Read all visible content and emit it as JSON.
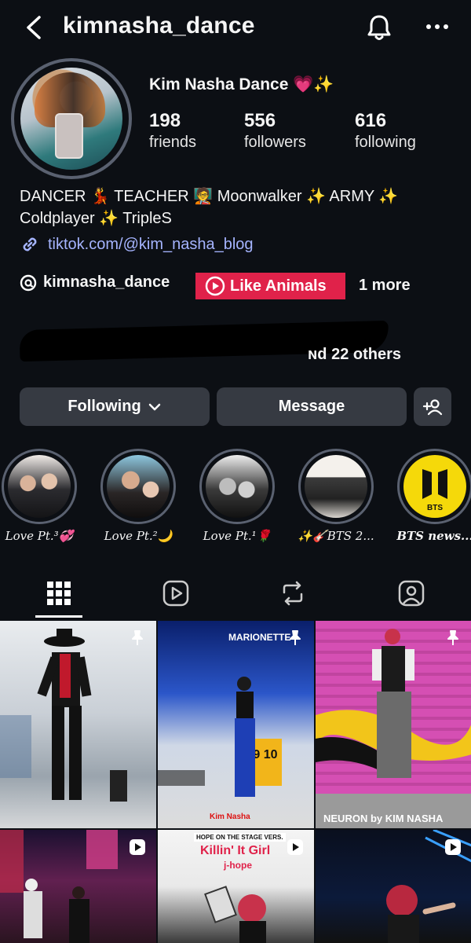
{
  "header": {
    "username": "kimnasha_dance"
  },
  "profile": {
    "display_name": "Kim Nasha Dance 💗✨",
    "stats": [
      {
        "value": "198",
        "label": "friends"
      },
      {
        "value": "556",
        "label": "followers"
      },
      {
        "value": "616",
        "label": "following"
      }
    ],
    "bio_line1": "DANCER 💃 TEACHER 🧑‍🏫 Moonwalker ✨ ARMY ✨",
    "bio_line2": "Coldplayer ✨ TripleS",
    "link": "tiktok.com/@kim_nasha_blog",
    "threads_handle": "kimnasha_dance",
    "pill_label": "Like Animals",
    "more_label": "1 more",
    "mutual_text": "ɴd 22 others"
  },
  "actions": {
    "following_label": "Following",
    "message_label": "Message"
  },
  "highlights": [
    {
      "caption": "Love Pt.³💞"
    },
    {
      "caption": "Love Pt.²🌙"
    },
    {
      "caption": "Love Pt.¹🌹"
    },
    {
      "caption": "✨🎸BTS 2..."
    },
    {
      "caption": "BTS news...",
      "badge_text": "BTS"
    }
  ],
  "grid": [
    {
      "type": "pinned"
    },
    {
      "type": "pinned",
      "overlay_top": "MARIONETTE",
      "overlay_bottom": "Kim Nasha",
      "sign": "9 10"
    },
    {
      "type": "pinned",
      "overlay_bottom": "NEURON by KIM NASHA"
    },
    {
      "type": "reel"
    },
    {
      "type": "reel",
      "overlay_top": "HOPE ON THE STAGE VERS.",
      "title": "Killin' It Girl",
      "subtitle": "j-hope"
    },
    {
      "type": "reel"
    }
  ],
  "colors": {
    "background": "#0c0f14",
    "button": "#363a42",
    "pill": "#e0224a",
    "link": "#a5b4ff"
  }
}
